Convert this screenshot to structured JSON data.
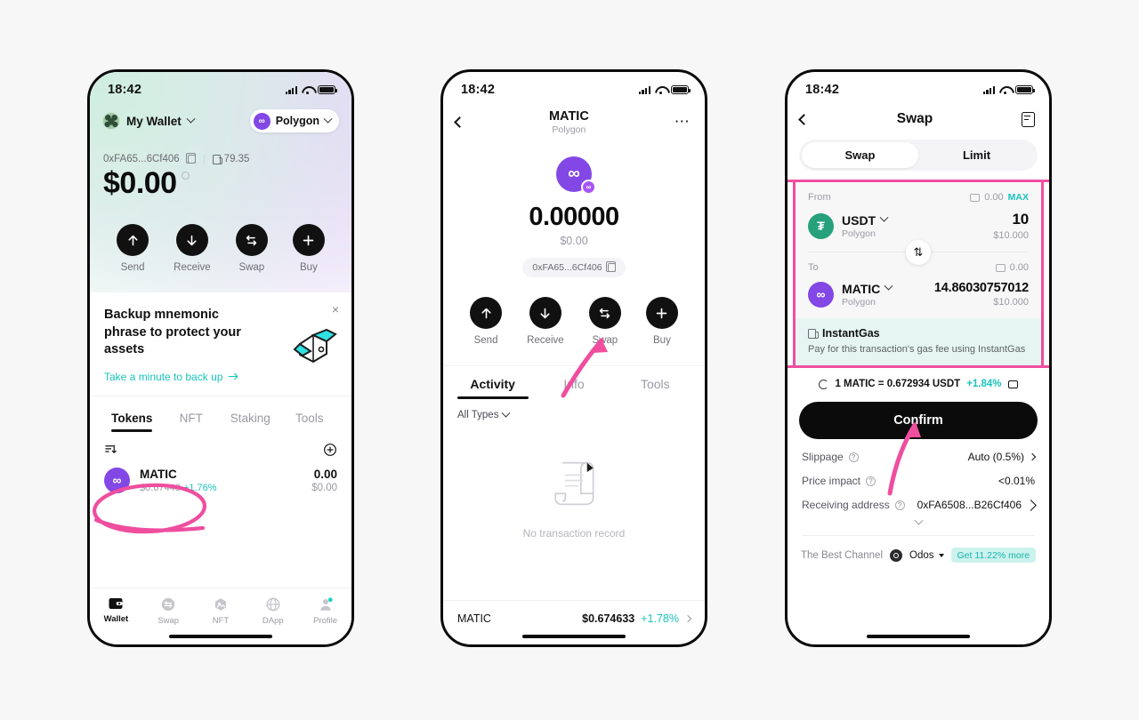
{
  "status_bar": {
    "time": "18:42"
  },
  "phone1": {
    "wallet_name": "My Wallet",
    "network": "Polygon",
    "address": "0xFA65...6Cf406",
    "gas_value": "79.35",
    "balance": "$0.00",
    "actions": [
      {
        "label": "Send",
        "icon": "arrow-up-icon"
      },
      {
        "label": "Receive",
        "icon": "arrow-down-icon"
      },
      {
        "label": "Swap",
        "icon": "swap-arrows-icon"
      },
      {
        "label": "Buy",
        "icon": "plus-icon"
      }
    ],
    "backup": {
      "title": "Backup mnemonic phrase to protect your assets",
      "link": "Take a minute to back up",
      "close": "×"
    },
    "tabs": [
      {
        "label": "Tokens",
        "active": true
      },
      {
        "label": "NFT",
        "active": false
      },
      {
        "label": "Staking",
        "active": false
      },
      {
        "label": "Tools",
        "active": false
      }
    ],
    "token": {
      "symbol": "MATIC",
      "price": "$0.67448",
      "change": "+1.76%",
      "amount": "0.00",
      "usd": "$0.00"
    },
    "bottom_nav": [
      {
        "label": "Wallet",
        "active": true
      },
      {
        "label": "Swap",
        "active": false
      },
      {
        "label": "NFT",
        "active": false
      },
      {
        "label": "DApp",
        "active": false
      },
      {
        "label": "Profile",
        "active": false
      }
    ]
  },
  "phone2": {
    "title": "MATIC",
    "subtitle": "Polygon",
    "amount": "0.00000",
    "usd": "$0.00",
    "address_chip": "0xFA65...6Cf406",
    "actions": [
      {
        "label": "Send",
        "icon": "arrow-up-icon"
      },
      {
        "label": "Receive",
        "icon": "arrow-down-icon"
      },
      {
        "label": "Swap",
        "icon": "swap-arrows-icon"
      },
      {
        "label": "Buy",
        "icon": "plus-icon"
      }
    ],
    "tabs": [
      {
        "label": "Activity",
        "active": true
      },
      {
        "label": "Info",
        "active": false
      },
      {
        "label": "Tools",
        "active": false
      }
    ],
    "filter": "All Types",
    "empty_label": "No transaction record",
    "footer": {
      "symbol": "MATIC",
      "price": "$0.674633",
      "change": "+1.78%"
    }
  },
  "phone3": {
    "title": "Swap",
    "segments": [
      {
        "label": "Swap",
        "active": true
      },
      {
        "label": "Limit",
        "active": false
      }
    ],
    "from": {
      "label": "From",
      "balance": "0.00",
      "max": "MAX",
      "symbol": "USDT",
      "network": "Polygon",
      "amount": "10",
      "usd": "$10.000"
    },
    "to": {
      "label": "To",
      "balance": "0.00",
      "symbol": "MATIC",
      "network": "Polygon",
      "amount": "14.86030757012",
      "usd": "$10.000"
    },
    "gas_banner": {
      "title": "InstantGas",
      "subtitle": "Pay for this transaction's gas fee using InstantGas"
    },
    "rate": {
      "text": "1 MATIC = 0.672934 USDT",
      "change": "+1.84%"
    },
    "confirm": "Confirm",
    "details": [
      {
        "label": "Slippage",
        "value": "Auto (0.5%)",
        "chevron": true,
        "edit": false
      },
      {
        "label": "Price impact",
        "value": "<0.01%",
        "chevron": false,
        "edit": false
      },
      {
        "label": "Receiving address",
        "value": "0xFA6508...B26Cf406",
        "chevron": false,
        "edit": true
      }
    ],
    "channel": {
      "label": "The Best Channel",
      "name": "Odos",
      "badge": "Get 11.22% more"
    }
  },
  "colors": {
    "accent_pink": "#ef4e9f",
    "teal": "#19c3bb",
    "polygon_purple": "#8247e5",
    "usdt_green": "#26a17b",
    "gas_banner_bg": "#e7f5f2",
    "dark": "#0b0b0b"
  }
}
